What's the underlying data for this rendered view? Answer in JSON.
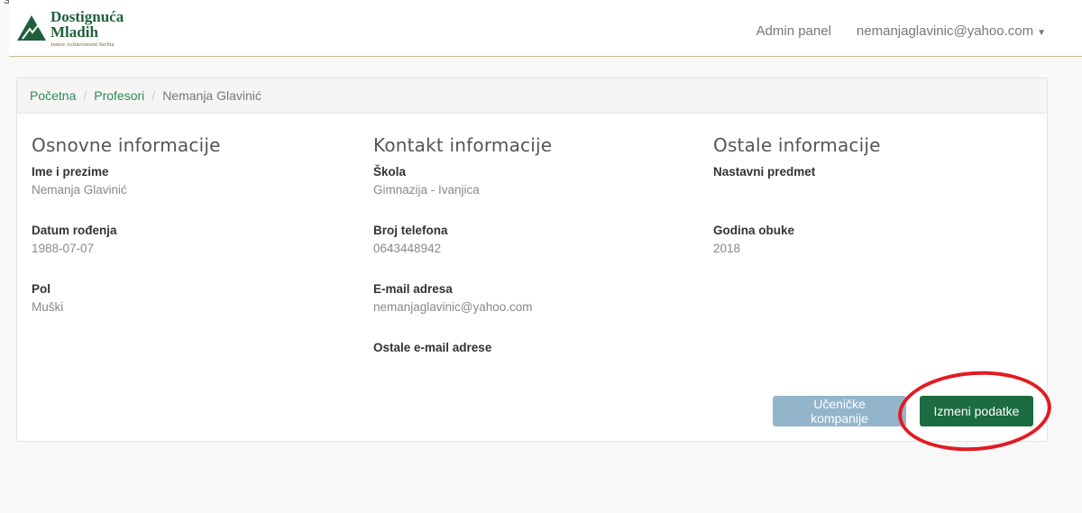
{
  "crop": {
    "left": "snot",
    "right": "ispod"
  },
  "navbar": {
    "logo": {
      "line1": "Dostignuća",
      "line2": "Mladih",
      "sub": "Junior Achievement Serbia"
    },
    "admin_panel": "Admin panel",
    "user_email": "nemanjaglavinic@yahoo.com"
  },
  "breadcrumb": {
    "home": "Početna",
    "section": "Profesori",
    "current": "Nemanja Glavinić"
  },
  "basic": {
    "title": "Osnovne informacije",
    "name_label": "Ime i prezime",
    "name_value": "Nemanja Glavinić",
    "dob_label": "Datum rođenja",
    "dob_value": "1988-07-07",
    "gender_label": "Pol",
    "gender_value": "Muški"
  },
  "contact": {
    "title": "Kontakt informacije",
    "school_label": "Škola",
    "school_value": "Gimnazija - Ivanjica",
    "phone_label": "Broj telefona",
    "phone_value": "0643448942",
    "email_label": "E-mail adresa",
    "email_value": "nemanjaglavinic@yahoo.com",
    "other_email_label": "Ostale e-mail adrese"
  },
  "other": {
    "title": "Ostale informacije",
    "subject_label": "Nastavni predmet",
    "training_year_label": "Godina obuke",
    "training_year_value": "2018"
  },
  "actions": {
    "companies": "Učeničke kompanije",
    "edit": "Izmeni podatke"
  },
  "colors": {
    "brand_green": "#1d6b40",
    "link_green": "#2e8b57",
    "highlight_red": "#e11b22",
    "button_blue": "#93b5cc"
  }
}
